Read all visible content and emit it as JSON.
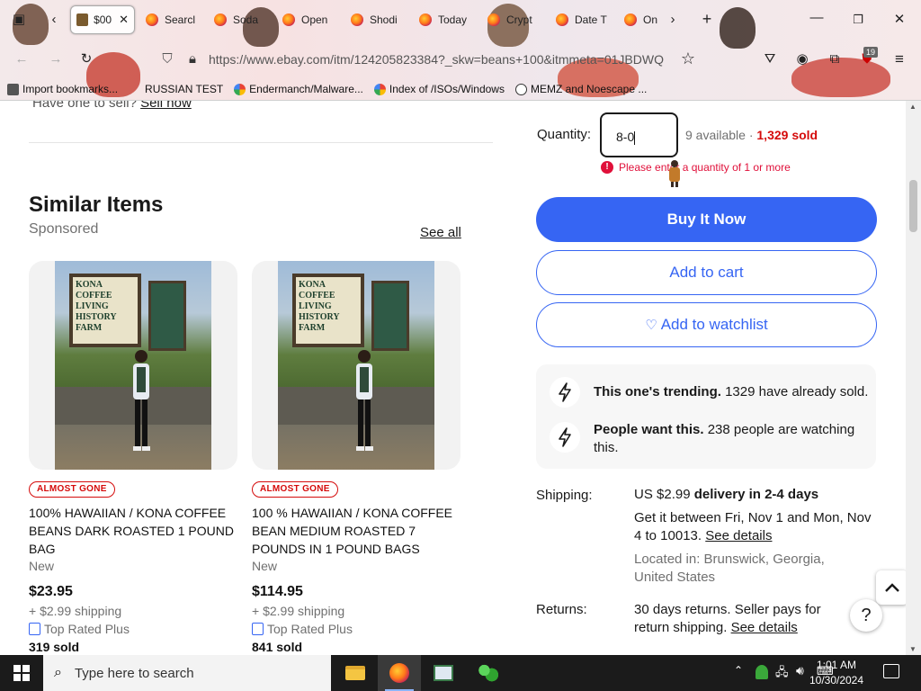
{
  "browser": {
    "tabs": [
      {
        "title": "$00",
        "active": true
      },
      {
        "title": "Searcl"
      },
      {
        "title": "Soda"
      },
      {
        "title": "Open"
      },
      {
        "title": "Shodi"
      },
      {
        "title": "Today"
      },
      {
        "title": "Crypt"
      },
      {
        "title": "Date T"
      },
      {
        "title": "On"
      }
    ],
    "url": "https://www.ebay.com/itm/124205823384?_skw=beans+100&itmmeta=01JBDWQ",
    "extension_badge": "19",
    "bookmarks": [
      {
        "label": "Import bookmarks..."
      },
      {
        "label": "RUSSIAN TEST"
      },
      {
        "label": "Endermanch/Malware..."
      },
      {
        "label": "Index of /ISOs/Windows"
      },
      {
        "label": "MEMZ and Noescape ..."
      }
    ]
  },
  "page": {
    "sell_prompt": "Have one to sell?",
    "sell_link": "Sell now",
    "similar": {
      "heading": "Similar Items",
      "sponsored": "Sponsored",
      "see_all": "See all",
      "items": [
        {
          "sign_text": "KONA COFFEE LIVING HISTORY FARM",
          "badge": "ALMOST GONE",
          "title": "100% HAWAIIAN / KONA COFFEE BEANS DARK ROASTED 1 POUND BAG",
          "condition": "New",
          "price": "$23.95",
          "shipping": "+ $2.99 shipping",
          "seller_badge": "Top Rated Plus",
          "sold": "319 sold"
        },
        {
          "sign_text": "KONA COFFEE LIVING HISTORY FARM",
          "badge": "ALMOST GONE",
          "title": "100 % HAWAIIAN / KONA COFFEE BEAN MEDIUM ROASTED 7 POUNDS IN 1 POUND BAGS",
          "condition": "New",
          "price": "$114.95",
          "shipping": "+ $2.99 shipping",
          "seller_badge": "Top Rated Plus",
          "sold": "841 sold"
        }
      ]
    },
    "purchase": {
      "quantity_label": "Quantity:",
      "quantity_value": "8-0",
      "available": "9 available",
      "separator": "·",
      "sold": "1,329 sold",
      "error": "Please enter a quantity of 1 or more",
      "buy_now": "Buy It Now",
      "add_to_cart": "Add to cart",
      "watchlist": "Add to watchlist",
      "watch_glyph": "♡",
      "trending_bold": "This one's trending.",
      "trending_text": "1329 have already sold.",
      "watch_bold": "People want this.",
      "watch_text": "238 people are watching this.",
      "shipping_label": "Shipping:",
      "shipping_price": "US $2.99",
      "shipping_delivery": "delivery in 2-4 days",
      "shipping_dates": "Get it between Fri, Nov 1 and Mon, Nov 4 to 10013.",
      "see_details": "See details",
      "located": "Located in: Brunswick, Georgia, United States",
      "returns_label": "Returns:",
      "returns_text": "30 days returns. Seller pays for return shipping.",
      "returns_link": "See details"
    },
    "help_glyph": "?"
  },
  "taskbar": {
    "search_placeholder": "Type here to search",
    "time": "1:01 AM",
    "date": "10/30/2024"
  },
  "colors": {
    "accent": "#3665f3",
    "error": "#e0103a",
    "sold_red": "#d50b0b"
  }
}
